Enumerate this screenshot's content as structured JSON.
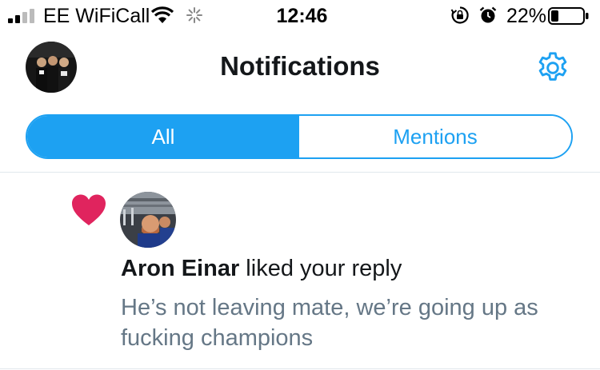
{
  "status_bar": {
    "carrier": "EE WiFiCall",
    "time": "12:46",
    "battery_percent": "22%",
    "icons": [
      "signal-icon",
      "wifi-icon",
      "activity-spinner-icon",
      "rotation-lock-icon",
      "alarm-icon",
      "battery-icon"
    ]
  },
  "header": {
    "title": "Notifications",
    "settings_icon": "gear-icon"
  },
  "tabs": [
    {
      "label": "All",
      "active": true
    },
    {
      "label": "Mentions",
      "active": false
    }
  ],
  "colors": {
    "accent": "#1da1f2",
    "like": "#e0245e",
    "secondary_text": "#657786"
  },
  "notifications": [
    {
      "type": "like",
      "icon": "heart-icon",
      "user_name": "Aron Einar",
      "action": " liked your reply",
      "text": "He’s not leaving mate, we’re going up as fucking champions"
    }
  ]
}
